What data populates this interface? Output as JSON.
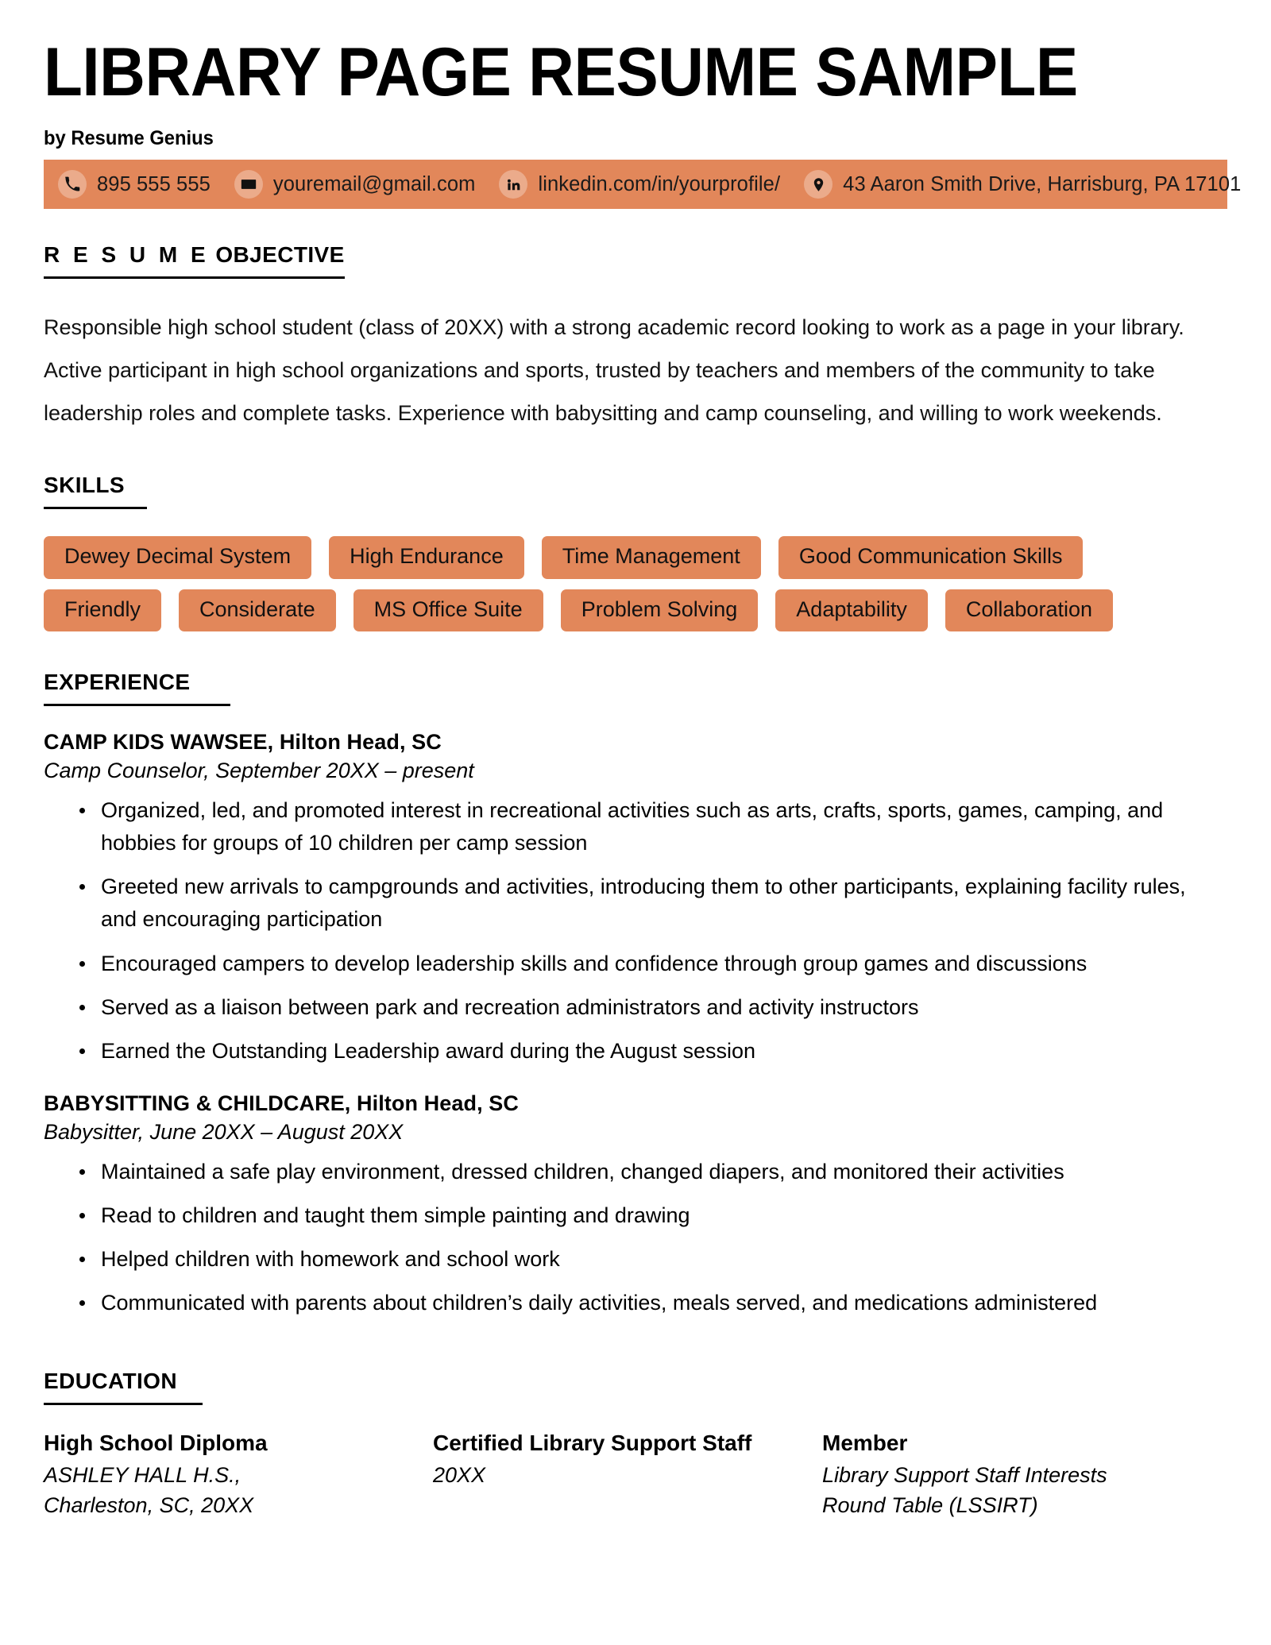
{
  "document": {
    "title": "LIBRARY PAGE RESUME SAMPLE",
    "byline": "by Resume Genius"
  },
  "theme": {
    "accent": "#e2875a",
    "text": "#000000",
    "background": "#ffffff"
  },
  "contact": {
    "phone": {
      "icon": "phone-icon",
      "value": "895 555 555"
    },
    "email": {
      "icon": "envelope-icon",
      "value": "youremail@gmail.com"
    },
    "linkedin": {
      "icon": "linkedin-icon",
      "value": "linkedin.com/in/yourprofile/"
    },
    "address": {
      "icon": "map-pin-icon",
      "value": "43 Aaron Smith Drive, Harrisburg, PA 17101"
    }
  },
  "objective": {
    "heading_spaced": "R E S U M E",
    "heading_rest": " OBJECTIVE",
    "line1": "Responsible high school student (class of 20XX) with a strong academic record looking to work as a page in your library.",
    "line2": "Active participant in high school organizations and sports, trusted by teachers and members of the community to take",
    "line3": "leadership roles and complete tasks. Experience with babysitting and camp counseling, and willing to work weekends."
  },
  "skills": {
    "heading": "SKILLS",
    "items": [
      "Dewey Decimal System",
      "High Endurance",
      "Time Management",
      "Good Communication Skills",
      "Friendly",
      "Considerate",
      "MS Office Suite",
      "Problem Solving",
      "Adaptability",
      "Collaboration"
    ]
  },
  "experience": {
    "heading": "EXPERIENCE",
    "jobs": [
      {
        "company": "CAMP KIDS WAWSEE, Hilton Head, SC",
        "role": "Camp Counselor, September 20XX – present",
        "bullets": [
          "Organized, led, and promoted interest in recreational activities such as arts, crafts, sports, games, camping, and hobbies for groups of 10 children per camp session",
          "Greeted new arrivals to campgrounds and activities, introducing them to other participants, explaining facility rules, and encouraging participation",
          "Encouraged campers to develop leadership skills and confidence through group games and discussions",
          "Served as a liaison between park and recreation administrators and activity instructors",
          "Earned the Outstanding Leadership award during the August session"
        ]
      },
      {
        "company": "BABYSITTING & CHILDCARE, Hilton Head, SC",
        "role": "Babysitter, June 20XX – August 20XX",
        "bullets": [
          "Maintained a safe play environment, dressed children, changed diapers, and monitored their activities",
          "Read to children and taught them simple painting and drawing",
          "Helped children with homework and school work",
          "Communicated with parents about children’s daily activities, meals served, and medications administered"
        ]
      }
    ]
  },
  "education": {
    "heading": "EDUCATION",
    "entries": [
      {
        "title": "High School Diploma",
        "detail": "ASHLEY HALL H.S.,\nCharleston, SC, 20XX"
      },
      {
        "title": "Certified Library Support Staff",
        "detail": "20XX"
      },
      {
        "title": "Member",
        "detail": "Library Support Staff Interests Round Table (LSSIRT)"
      }
    ]
  }
}
